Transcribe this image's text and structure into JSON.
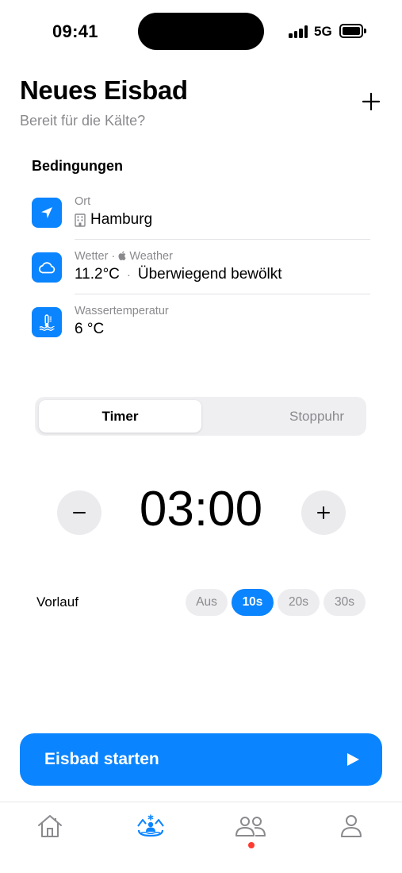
{
  "status_bar": {
    "time": "09:41",
    "network": "5G"
  },
  "header": {
    "title": "Neues Eisbad",
    "subtitle": "Bereit für die Kälte?"
  },
  "conditions": {
    "title": "Bedingungen",
    "location": {
      "label": "Ort",
      "value": "Hamburg",
      "icon": "location-arrow-icon"
    },
    "weather": {
      "label": "Wetter · ",
      "source": "Weather",
      "temperature": "11.2°C",
      "separator": "·",
      "description": "Überwiegend bewölkt",
      "icon": "cloud-icon"
    },
    "water": {
      "label": "Wassertemperatur",
      "value": "6 °C",
      "icon": "water-thermometer-icon"
    }
  },
  "mode": {
    "tabs": [
      "Timer",
      "Stoppuhr"
    ],
    "selected": "Timer"
  },
  "timer": {
    "value": "03:00",
    "decrement": "−",
    "increment": "+"
  },
  "countdown": {
    "label": "Vorlauf",
    "options": [
      "Aus",
      "10s",
      "20s",
      "30s"
    ],
    "selected": "10s"
  },
  "start_button": {
    "label": "Eisbad starten"
  },
  "tabbar": {
    "items": [
      "home-icon",
      "ice-bath-icon",
      "community-icon",
      "profile-icon"
    ],
    "active": "ice-bath-icon",
    "accent": "#0a84ff",
    "badge_color": "#ff3b30"
  },
  "colors": {
    "accent": "#0a84ff",
    "secondary_text": "#8a8a8e"
  }
}
